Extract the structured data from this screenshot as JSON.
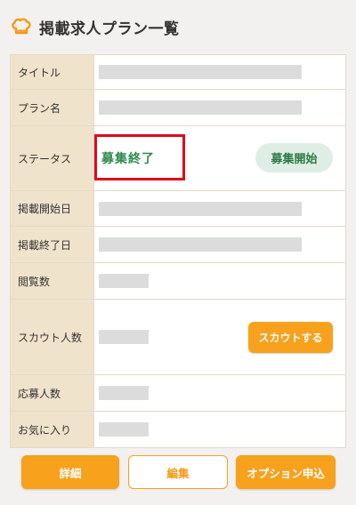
{
  "header": {
    "title": "掲載求人プラン一覧"
  },
  "rows": [
    {
      "label": "タイトル"
    },
    {
      "label": "プラン名"
    },
    {
      "label": "ステータス",
      "status": "募集終了",
      "action_label": "募集開始"
    },
    {
      "label": "掲載開始日"
    },
    {
      "label": "掲載終了日"
    },
    {
      "label": "閲覧数"
    },
    {
      "label": "スカウト人数",
      "action_label": "スカウトする"
    },
    {
      "label": "応募人数"
    },
    {
      "label": "お気に入り"
    }
  ],
  "footer": {
    "detail_label": "詳細",
    "edit_label": "編集",
    "option_label": "オプション申込"
  },
  "colors": {
    "accent": "#f7a11c",
    "status_green": "#2f8a4e",
    "highlight_red": "#e0081c",
    "label_bg": "#f0e3cc"
  }
}
